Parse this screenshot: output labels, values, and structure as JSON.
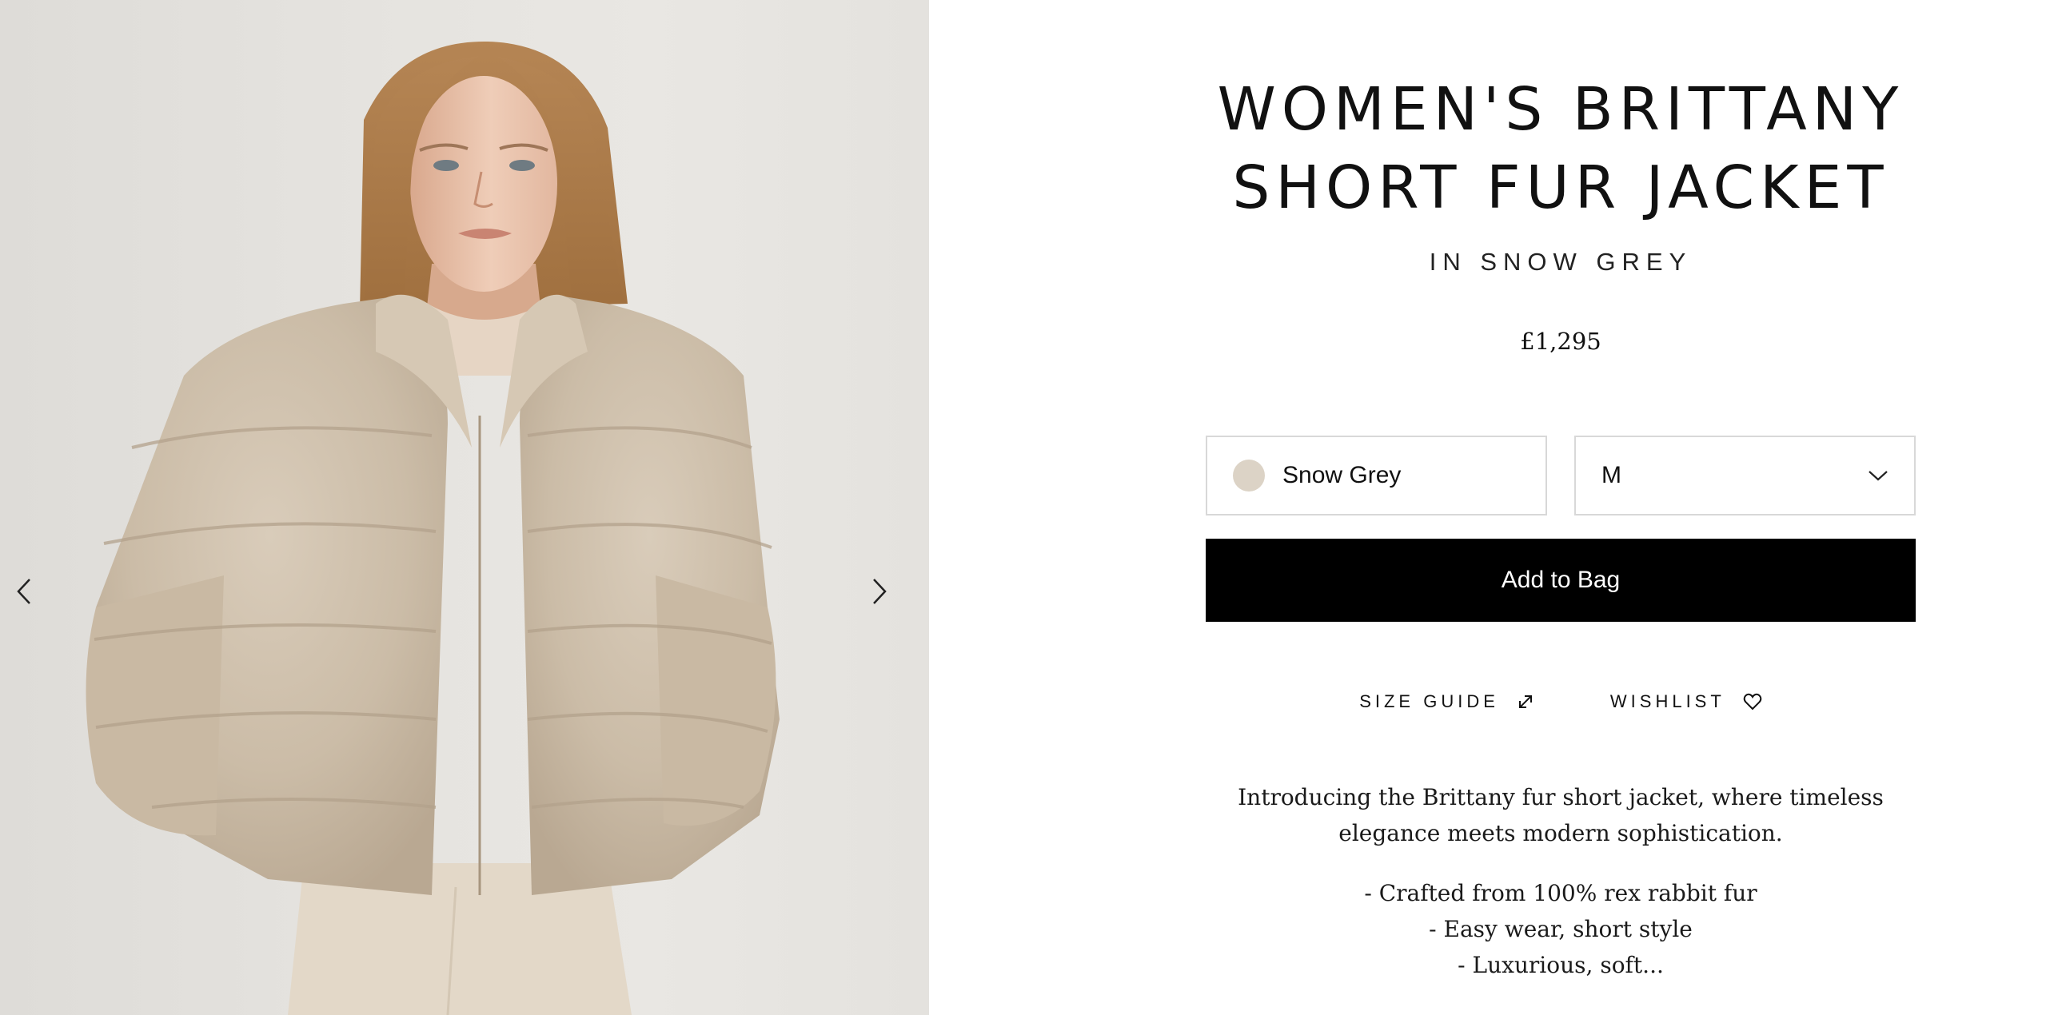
{
  "product": {
    "title_line1": "WOMEN'S BRITTANY",
    "title_line2": "SHORT FUR JACKET",
    "subtitle": "IN SNOW GREY",
    "price": "£1,295"
  },
  "options": {
    "color_label": "Snow Grey",
    "color_swatch": "#dcd3c6",
    "size_value": "M"
  },
  "actions": {
    "add_to_bag": "Add to Bag",
    "size_guide": "SIZE GUIDE",
    "wishlist": "WISHLIST"
  },
  "description": {
    "intro": "Introducing the Brittany fur short jacket, where timeless elegance meets modern sophistication.",
    "bullets": [
      "- Crafted from 100% rex rabbit fur",
      "- Easy wear, short style",
      "- Luxurious, soft..."
    ]
  },
  "colors": {
    "button_bg": "#000000",
    "button_text": "#ffffff",
    "border": "#d8d8d8"
  },
  "icons": {
    "prev": "chevron-left-icon",
    "next": "chevron-right-icon",
    "dropdown": "chevron-down-icon",
    "size_guide": "resize-arrow-icon",
    "wishlist": "heart-icon"
  }
}
